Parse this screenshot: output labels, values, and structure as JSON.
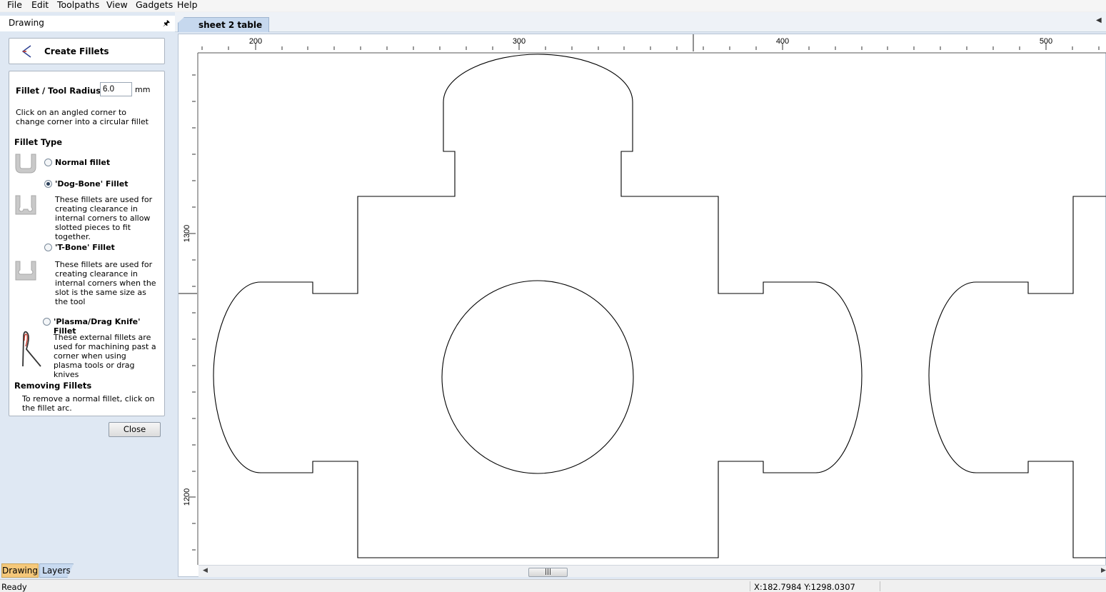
{
  "menu": [
    "File",
    "Edit",
    "Toolpaths",
    "View",
    "Gadgets",
    "Help"
  ],
  "panel": {
    "title": "Drawing",
    "pin_icon": "pin-icon",
    "heading": "Create Fillets",
    "radius_label": "Fillet / Tool Radius:",
    "radius_value": "6.0",
    "radius_unit": "mm",
    "hint": "Click on an angled corner to change corner into a circular fillet",
    "fillet_type_label": "Fillet Type",
    "options": [
      {
        "label": "Normal fillet",
        "selected": false,
        "description": ""
      },
      {
        "label": "'Dog-Bone' Fillet",
        "selected": true,
        "description": "These fillets are used for creating clearance in internal corners to allow slotted pieces to fit together."
      },
      {
        "label": "'T-Bone' Fillet",
        "selected": false,
        "description": "These fillets are used for creating clearance in internal corners when the slot is the same size as the tool"
      },
      {
        "label": "'Plasma/Drag Knife' Fillet",
        "selected": false,
        "description": "These external fillets are used for machining past a corner when using plasma tools or drag knives"
      }
    ],
    "removing_label": "Removing Fillets",
    "removing_text": "To remove a normal fillet, click on the fillet arc.",
    "close_label": "Close",
    "tabs": [
      "Drawing",
      "Layers"
    ]
  },
  "document": {
    "tab_label": "sheet 2 table",
    "ruler_x_labels": [
      "200",
      "300",
      "400",
      "500"
    ],
    "ruler_y_labels": [
      "1300",
      "1200"
    ]
  },
  "status": {
    "ready": "Ready",
    "coords": "X:182.7984 Y:1298.0307"
  }
}
